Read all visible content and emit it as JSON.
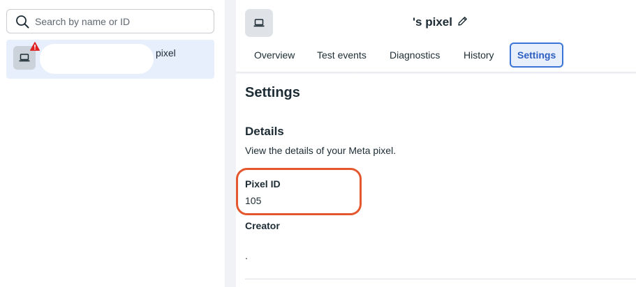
{
  "search": {
    "placeholder": "Search by name or ID",
    "icon": "search-icon"
  },
  "pixel_list": {
    "items": [
      {
        "label": "pixel",
        "icon": "laptop-icon",
        "status": "warning",
        "selected": true
      }
    ]
  },
  "header": {
    "title": "'s pixel",
    "icon": "laptop-icon",
    "edit_icon": "pencil-icon"
  },
  "tabs": [
    {
      "label": "Overview",
      "active": false
    },
    {
      "label": "Test events",
      "active": false
    },
    {
      "label": "Diagnostics",
      "active": false
    },
    {
      "label": "History",
      "active": false
    },
    {
      "label": "Settings",
      "active": true
    }
  ],
  "settings": {
    "title": "Settings",
    "details_title": "Details",
    "details_description": "View the details of your Meta pixel.",
    "pixel_id_label": "Pixel ID",
    "pixel_id_value": "105",
    "creator_label": "Creator",
    "creator_value": "."
  },
  "colors": {
    "accent": "#3a74d6",
    "selected_bg": "#e7eefc",
    "highlight": "#e4572e",
    "warning": "#e02020"
  }
}
